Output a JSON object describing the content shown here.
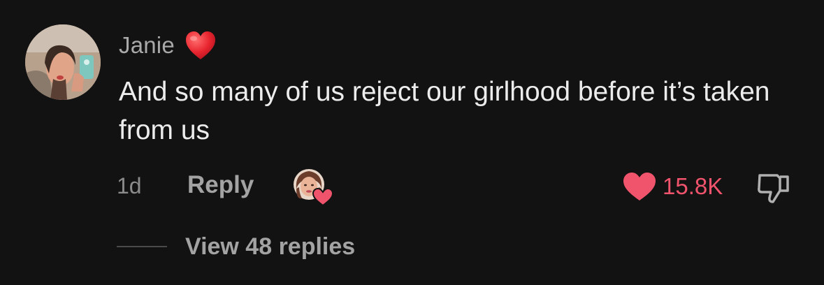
{
  "comment": {
    "username": "Janie",
    "username_emoji": "red-heart",
    "text": "And so many of us reject our girlhood before it’s taken from us",
    "time_ago": "1d",
    "reply_label": "Reply",
    "like_count": "15.8K",
    "view_replies_label": "View 48 replies"
  },
  "colors": {
    "background": "#121212",
    "like_accent": "#f0546c",
    "username": "#a9a9a9",
    "muted": "#8b8b8b"
  },
  "icons": {
    "emoji": "red-heart-emoji",
    "creator_liked": "creator-liked-avatar-with-heart",
    "like": "heart-filled-icon",
    "dislike": "thumbs-down-icon"
  }
}
